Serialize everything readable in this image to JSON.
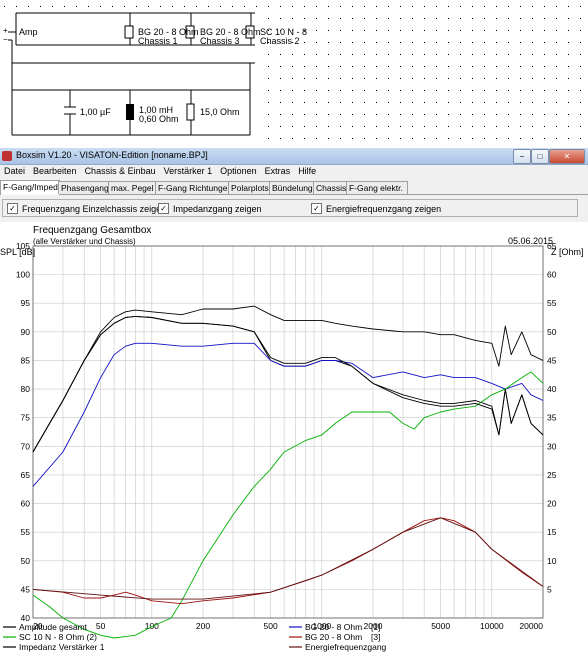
{
  "schematic": {
    "amp_label": "Amp",
    "plus": "+",
    "minus": "−",
    "chassis": [
      {
        "name": "BG 20 - 8 Ohm",
        "sub": "Chassis 1"
      },
      {
        "name": "BG 20 - 8 Ohm",
        "sub": "Chassis 3"
      },
      {
        "name": "SC 10 N - 8",
        "sub": "Chassis 2"
      }
    ],
    "components": [
      {
        "label": "1,00 µF",
        "kind": "capacitor-icon"
      },
      {
        "label": "1,00 mH",
        "label2": "0,60 Ohm",
        "kind": "inductor-icon"
      },
      {
        "label": "15,0 Ohm",
        "kind": "resistor-icon"
      }
    ]
  },
  "window": {
    "title": "Boxsim V1.20 - VISATON-Edition [noname.BPJ]",
    "buttons": {
      "minimize": "−",
      "maximize": "□",
      "close": "✕"
    },
    "menu": [
      "Datei",
      "Bearbeiten",
      "Chassis & Einbau",
      "Verstärker 1",
      "Optionen",
      "Extras",
      "Hilfe"
    ],
    "tabs": [
      "F-Gang/Imped.",
      "Phasengang",
      "max. Pegel",
      "F-Gang Richtungen",
      "Polarplots",
      "Bündelung",
      "Chassis",
      "F-Gang elektr."
    ],
    "active_tab": 0,
    "options": [
      {
        "label": "Frequenzgang Einzelchassis zeigen",
        "checked": true
      },
      {
        "label": "Impedanzgang zeigen",
        "checked": true
      },
      {
        "label": "Energiefrequenzgang zeigen",
        "checked": true
      }
    ],
    "check_mark": "✓"
  },
  "chart_data": {
    "type": "line",
    "title": "Frequenzgang Gesamtbox",
    "subtitle": "(alle Verstärker und Chassis)",
    "date": "05.06.2015",
    "ylabel_left": "SPL [dB]",
    "ylabel_right": "Z [Ohm]",
    "x_scale": "log",
    "xlim": [
      20,
      20000
    ],
    "ylim_left": [
      40,
      105
    ],
    "ylim_right": [
      0,
      65
    ],
    "xticks": [
      20,
      50,
      100,
      200,
      500,
      1000,
      2000,
      5000,
      10000,
      20000
    ],
    "xtick_labels": [
      "20",
      "50",
      "100",
      "200",
      "500",
      "1000",
      "2000",
      "5000",
      "10000",
      "20000"
    ],
    "yticks_left": [
      40,
      45,
      50,
      55,
      60,
      65,
      70,
      75,
      80,
      85,
      90,
      95,
      100,
      105
    ],
    "yticks_right": [
      5,
      10,
      15,
      20,
      25,
      30,
      35,
      40,
      45,
      50,
      55,
      60,
      65
    ],
    "grid": true,
    "legend": [
      {
        "name": "Amplitude gesamt",
        "color": "#000000"
      },
      {
        "name": "SC 10 N - 8 Ohm (2)",
        "color": "#00b000"
      },
      {
        "name": "Impedanz Verstärker 1",
        "color": "#000000"
      },
      {
        "name": "BG 20 - 8 Ohm",
        "suffix": "[1]",
        "color": "#1010c8"
      },
      {
        "name": "BG 20 - 8 Ohm",
        "suffix": "[3]",
        "color": "#a01010"
      },
      {
        "name": "Energiefrequenzgang",
        "color": "#601010"
      }
    ],
    "series": [
      {
        "name": "Amplitude gesamt",
        "axis": "left",
        "color": "#000000",
        "x": [
          20,
          25,
          30,
          40,
          50,
          60,
          70,
          80,
          100,
          150,
          200,
          300,
          400,
          500,
          600,
          800,
          1000,
          1200,
          1500,
          2000,
          3000,
          4000,
          5000,
          6000,
          8000,
          10000,
          11000,
          12000,
          13000,
          15000,
          17000,
          20000
        ],
        "y": [
          69,
          74,
          78,
          85,
          90,
          92.5,
          93.5,
          93.8,
          93.5,
          93,
          94,
          94,
          94.5,
          93,
          92,
          92,
          92,
          91.5,
          91,
          90.5,
          90,
          90,
          89.5,
          89.5,
          88.5,
          88,
          84,
          91,
          86,
          90,
          86,
          85
        ]
      },
      {
        "name": "Amplitude gesamt (2)",
        "axis": "left",
        "color": "#000000",
        "x": [
          20,
          30,
          40,
          50,
          60,
          70,
          80,
          100,
          150,
          200,
          300,
          400,
          500,
          600,
          800,
          1000,
          1200,
          1500,
          2000,
          3000,
          4000,
          5000,
          6000,
          8000,
          10000,
          11000,
          12000,
          13000,
          15000,
          17000,
          20000
        ],
        "y": [
          69,
          78,
          85,
          89.5,
          91.5,
          92.5,
          92.7,
          92.5,
          91.5,
          91.5,
          91,
          90,
          85,
          84,
          84,
          85,
          85,
          84,
          81,
          79,
          78,
          77.5,
          77.5,
          78,
          77,
          72,
          80,
          74,
          79,
          74,
          72
        ]
      },
      {
        "name": "BG 20 - 8 Ohm",
        "suffix": "[1]",
        "axis": "left",
        "color": "#1010c8",
        "x": [
          20,
          30,
          40,
          50,
          60,
          70,
          80,
          100,
          150,
          200,
          300,
          400,
          500,
          600,
          800,
          1000,
          1200,
          1500,
          2000,
          3000,
          4000,
          5000,
          6000,
          8000,
          10000,
          12000,
          15000,
          17000,
          20000
        ],
        "y": [
          63,
          69,
          76,
          82,
          86,
          87.5,
          88,
          88,
          87.5,
          87.5,
          88,
          88,
          85,
          84,
          84,
          85,
          85,
          84.5,
          82,
          83,
          82,
          82.5,
          82,
          82,
          81,
          80,
          81,
          79,
          78
        ]
      },
      {
        "name": "SC 10 N - 8 Ohm (2)",
        "axis": "left",
        "color": "#00b000",
        "x": [
          20,
          25,
          30,
          40,
          50,
          60,
          80,
          100,
          130,
          150,
          200,
          300,
          400,
          500,
          600,
          800,
          1000,
          1200,
          1500,
          2000,
          2500,
          3000,
          3500,
          4000,
          5000,
          6000,
          8000,
          10000,
          12000,
          15000,
          17000,
          20000
        ],
        "y": [
          44,
          42,
          40,
          38,
          37,
          36.5,
          37,
          38.5,
          40,
          43,
          50,
          58,
          63,
          66,
          69,
          71,
          72,
          74,
          76,
          76,
          76,
          74,
          73,
          75,
          76,
          76.5,
          77,
          79,
          80,
          82,
          83,
          81
        ]
      },
      {
        "name": "Impedanz Verstärker 1",
        "axis": "right",
        "color": "#000000",
        "x": [
          20,
          30,
          40,
          50,
          60,
          70,
          80,
          100,
          150,
          200,
          300,
          400,
          500,
          600,
          800,
          1000,
          1200,
          1500,
          2000,
          3000,
          4000,
          5000,
          6000,
          8000,
          10000,
          11000,
          12000,
          13000,
          15000,
          17000,
          20000
        ],
        "y": [
          29,
          38,
          45,
          49.5,
          51.5,
          52.5,
          52.7,
          52.5,
          51.5,
          51.5,
          51,
          50,
          45.5,
          44.5,
          44.5,
          45.5,
          45.5,
          44,
          41,
          38.5,
          37.5,
          37,
          37,
          37.5,
          36.5,
          32,
          40,
          34,
          39,
          34,
          32
        ]
      },
      {
        "name": "BG 20 - 8 Ohm",
        "suffix": "[3]",
        "axis": "right",
        "color": "#a01010",
        "x": [
          20,
          30,
          40,
          50,
          60,
          70,
          80,
          100,
          150,
          200,
          300,
          500,
          800,
          1000,
          1500,
          2000,
          3000,
          4000,
          5000,
          6000,
          8000,
          10000,
          15000,
          20000
        ],
        "y": [
          5,
          4.5,
          3.5,
          3.5,
          4,
          4.5,
          4,
          3,
          2.5,
          3,
          3.5,
          4.5,
          6.5,
          7.5,
          10,
          12,
          15,
          17,
          17.5,
          17,
          15,
          12,
          8,
          5.5
        ]
      },
      {
        "name": "Energiefrequenzgang",
        "axis": "right",
        "color": "#601010",
        "x": [
          20,
          50,
          100,
          200,
          500,
          1000,
          2000,
          3000,
          5000,
          8000,
          10000,
          20000
        ],
        "y": [
          5,
          4,
          3.3,
          3.3,
          4.5,
          7.5,
          12,
          15,
          17.5,
          15,
          12,
          5.5
        ]
      }
    ]
  }
}
